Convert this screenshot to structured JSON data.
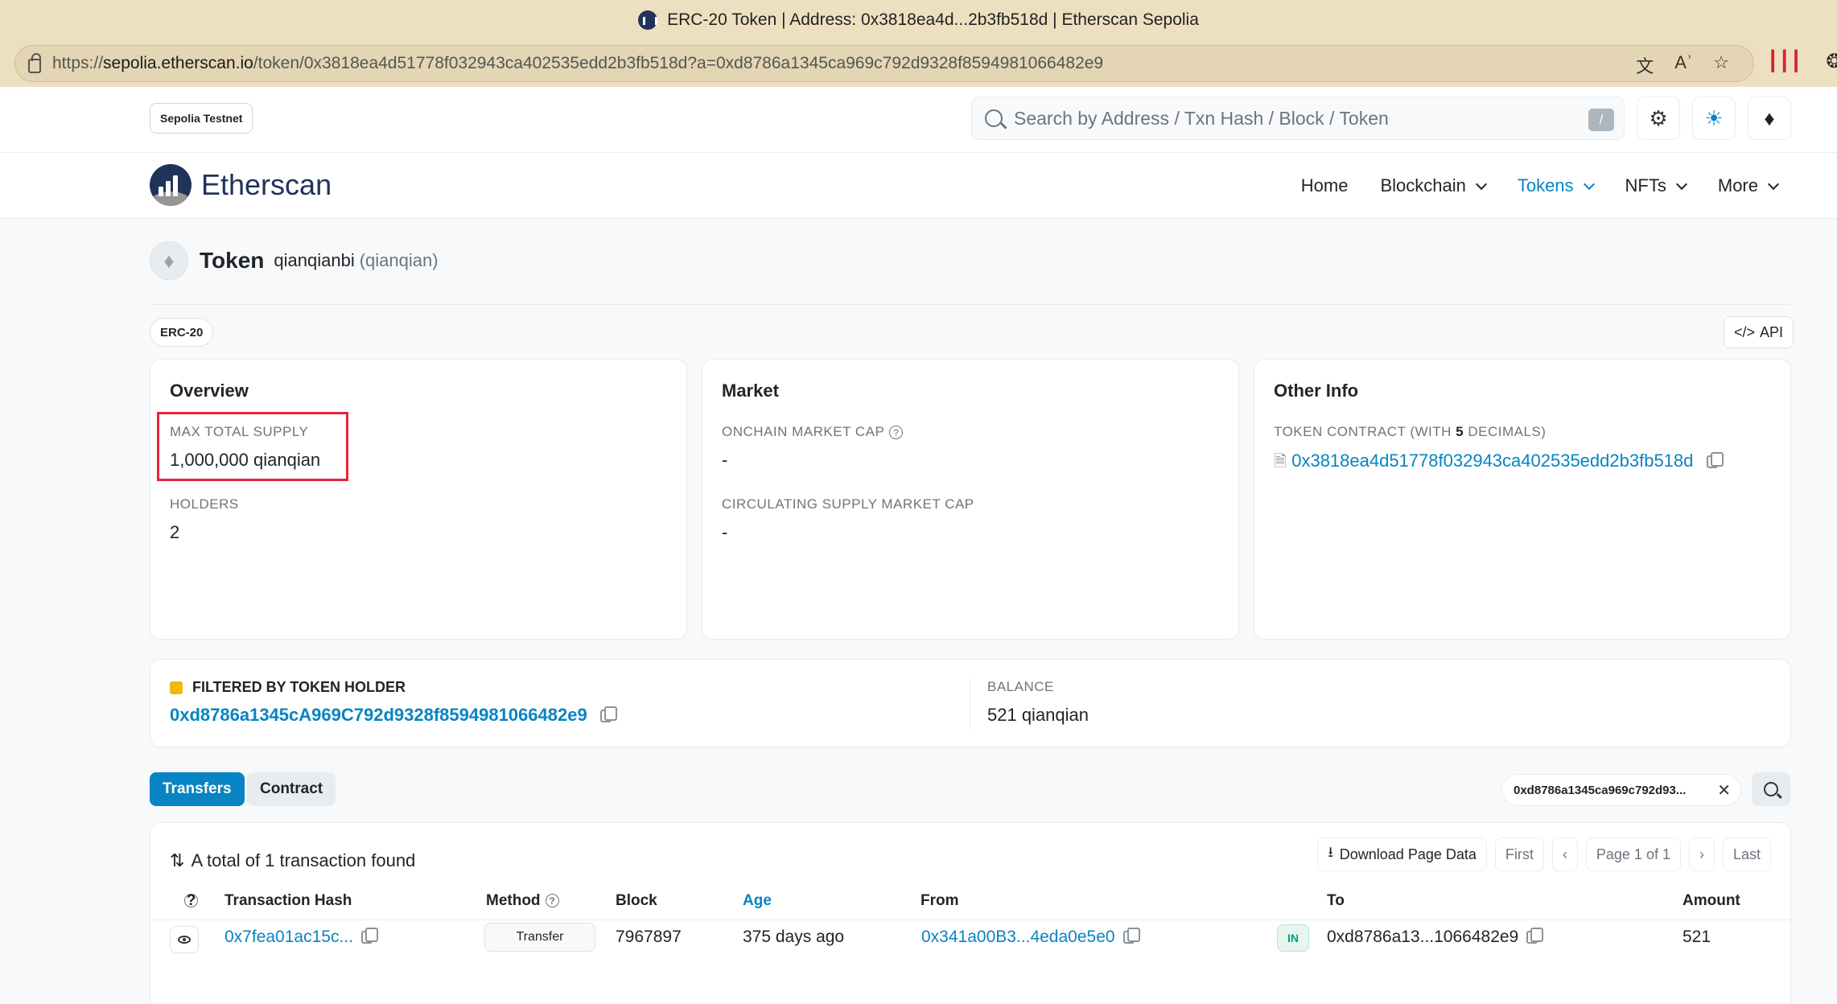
{
  "browser": {
    "window_title": "ERC-20 Token | Address: 0x3818ea4d...2b3fb518d | Etherscan Sepolia",
    "url_scheme": "https://",
    "url_host": "sepolia.etherscan.io",
    "url_path": "/token/0x3818ea4d51778f032943ca402535edd2b3fb518d?a=0xd8786a1345ca969c792d9328f8594981066482e9"
  },
  "topbar": {
    "network": "Sepolia Testnet",
    "search_placeholder": "Search by Address / Txn Hash / Block / Token",
    "search_shortcut": "/"
  },
  "nav": {
    "logo": "Etherscan",
    "items": [
      {
        "label": "Home",
        "dropdown": false
      },
      {
        "label": "Blockchain",
        "dropdown": true
      },
      {
        "label": "Tokens",
        "dropdown": true,
        "active": true
      },
      {
        "label": "NFTs",
        "dropdown": true
      },
      {
        "label": "More",
        "dropdown": true
      }
    ]
  },
  "token": {
    "title": "Token",
    "name": "qianqianbi",
    "symbol": "(qianqian)",
    "standard": "ERC-20",
    "api_label": "API"
  },
  "overview": {
    "title": "Overview",
    "max_supply_label": "MAX TOTAL SUPPLY",
    "max_supply_value": "1,000,000 qianqian",
    "holders_label": "HOLDERS",
    "holders_value": "2"
  },
  "market": {
    "title": "Market",
    "onchain_cap_label": "ONCHAIN MARKET CAP",
    "onchain_cap_value": "-",
    "circ_cap_label": "CIRCULATING SUPPLY MARKET CAP",
    "circ_cap_value": "-"
  },
  "other_info": {
    "title": "Other Info",
    "contract_label_pre": "TOKEN CONTRACT (WITH ",
    "contract_decimals": "5",
    "contract_label_post": " DECIMALS)",
    "contract_address": "0x3818ea4d51778f032943ca402535edd2b3fb518d"
  },
  "filter": {
    "label": "FILTERED BY TOKEN HOLDER",
    "address": "0xd8786a1345cA969C792d9328f8594981066482e9",
    "balance_label": "BALANCE",
    "balance_value": "521 qianqian"
  },
  "tabs": {
    "transfers": "Transfers",
    "contract": "Contract",
    "filter_chip": "0xd8786a1345ca969c792d93..."
  },
  "table": {
    "total_text": "A total of 1 transaction found",
    "download": "Download Page Data",
    "first": "First",
    "page": "Page 1 of 1",
    "last": "Last",
    "headers": {
      "hash": "Transaction Hash",
      "method": "Method",
      "block": "Block",
      "age": "Age",
      "from": "From",
      "to": "To",
      "amount": "Amount"
    },
    "rows": [
      {
        "hash": "0x7fea01ac15c...",
        "method": "Transfer",
        "block": "7967897",
        "age": "375 days ago",
        "from": "0x341a00B3...4eda0e5e0",
        "direction": "IN",
        "to": "0xd8786a13...1066482e9",
        "amount": "521"
      }
    ]
  }
}
